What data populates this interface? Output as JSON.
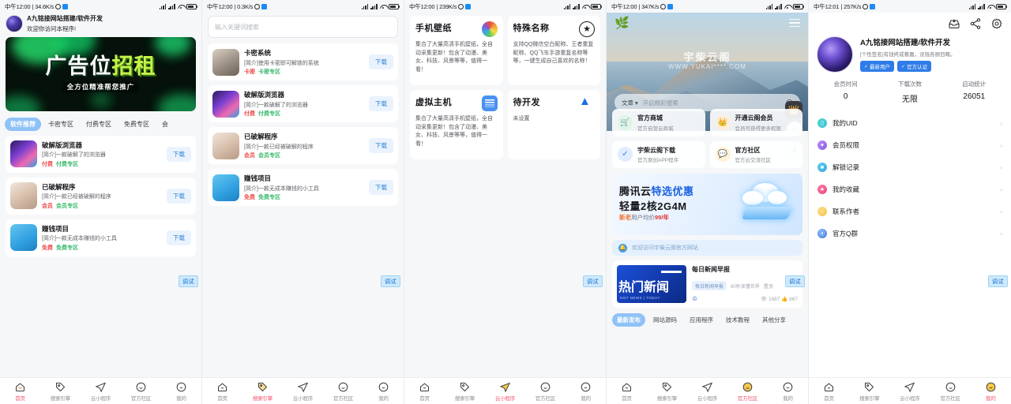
{
  "status_bar": {
    "time_1": "中午12:00",
    "net_1": "34.6K/s",
    "time_2": "中午12:00",
    "net_2": "0.3K/s",
    "time_3": "中午12:00",
    "net_3": "239K/s",
    "time_4": "中午12:00",
    "net_4": "347K/s",
    "time_5": "中午12:01",
    "net_5": "257K/s",
    "sep": "|"
  },
  "debug_label": "调试",
  "panel1": {
    "header": {
      "title": "A九铭接网站搭建/软件开发",
      "subtitle": "欢迎你访问本程序!"
    },
    "banner": {
      "main_white": "广告位",
      "main_green": "招租",
      "sub": "全方位精准帮您推广"
    },
    "tabs": [
      {
        "label": "软件推荐",
        "active": true
      },
      {
        "label": "卡密专区",
        "active": false
      },
      {
        "label": "付费专区",
        "active": false
      },
      {
        "label": "免费专区",
        "active": false
      },
      {
        "label": "会",
        "active": false
      }
    ],
    "items": [
      {
        "title": "破解版浏览器",
        "desc": "[简介]一款破解了的浏览器",
        "tag1": "付费",
        "tag2": "付费专区",
        "btn": "下载"
      },
      {
        "title": "已破解程序",
        "desc": "[简介]一款已经被破解的程序",
        "tag1": "会员",
        "tag2": "会员专区",
        "btn": "下载"
      },
      {
        "title": "赚钱项目",
        "desc": "[简介]一款无成本赚钱的小工具",
        "tag1": "免费",
        "tag2": "免费专区",
        "btn": "下载"
      }
    ]
  },
  "panel2": {
    "search_placeholder": "输入关键词搜索",
    "items": [
      {
        "title": "卡密系统",
        "desc": "[简介]使用卡密即可解锁的系统",
        "tag1": "卡密",
        "tag2": "卡密专区",
        "btn": "下载"
      },
      {
        "title": "破解版浏览器",
        "desc": "[简介]一款破解了的浏览器",
        "tag1": "付费",
        "tag2": "付费专区",
        "btn": "下载"
      },
      {
        "title": "已破解程序",
        "desc": "[简介]一款已经被破解的程序",
        "tag1": "会员",
        "tag2": "会员专区",
        "btn": "下载"
      },
      {
        "title": "赚钱项目",
        "desc": "[简介]一款无成本赚钱的小工具",
        "tag1": "免费",
        "tag2": "免费专区",
        "btn": "下载"
      }
    ]
  },
  "panel3": {
    "cards": [
      {
        "title": "手机壁纸",
        "desc": "集合了大量高清手机壁纸，全自动采集更新！包含了动漫、美女、科技、风景等等，值得一看！",
        "icon": "color-wheel-icon"
      },
      {
        "title": "特殊名称",
        "desc": "支持QQ微信空白昵称、王者重复昵称、QQ飞车手游重复名称等等，一键生成自己喜欢的名称！",
        "icon": "star-circle-icon"
      },
      {
        "title": "虚拟主机",
        "desc": "集合了大量高清手机壁纸，全自动采集更新！包含了动漫、美女、科技、风景等等，值得一看！",
        "icon": "server-list-icon"
      },
      {
        "title": "待开发",
        "desc": "未设置",
        "icon": "wings-icon"
      }
    ]
  },
  "panel4": {
    "hero": {
      "title": "宇柴云阁",
      "url": "WWW.YUKAI****.COM",
      "logo": "leaf-logo-icon",
      "menu": "hamburger-icon"
    },
    "search": {
      "scope": "文章",
      "placeholder": "开启精彩搜索"
    },
    "quick_links": [
      {
        "title": "官方商城",
        "sub": "官方自营云商城",
        "icon": "shop-icon"
      },
      {
        "title": "开通云阁会员",
        "sub": "会员可获得更多权限",
        "icon": "crown-icon"
      },
      {
        "title": "宇柴云阁下载",
        "sub": "官方原创APP程序",
        "icon": "verified-icon"
      },
      {
        "title": "官方社区",
        "sub": "官方云交流社区",
        "icon": "community-icon"
      }
    ],
    "ad": {
      "line1_a": "腾讯云",
      "line1_b": "特选优惠",
      "line2": "轻量2核2G4M",
      "line3_a": "新老",
      "line3_b": "用户均价",
      "line3_c": "99/年"
    },
    "notice": "欢迎访问宇柴云阁官方网站",
    "news": {
      "title": "每日新闻早报",
      "img_text": "热门新闻",
      "img_sub": "HOT NEWS | TODAY",
      "tag1": "每日新闻早报",
      "tag2": "60秒读懂世界",
      "tag3": "置顶",
      "views": "1687",
      "likes": "667"
    },
    "filters": [
      {
        "label": "最新发布",
        "active": true
      },
      {
        "label": "网站源码",
        "active": false
      },
      {
        "label": "应用程序",
        "active": false
      },
      {
        "label": "技术教程",
        "active": false
      },
      {
        "label": "其他分享",
        "active": false
      }
    ],
    "fabs": [
      "crown-fab-icon",
      "plus-fab-icon",
      "scroll-top-fab-icon"
    ]
  },
  "panel5": {
    "actions": [
      "inbox-icon",
      "share-icon",
      "gear-icon"
    ],
    "name": "A九铭接网站搭建/软件开发",
    "signature": "[个性签名]有钱终成眷属，没钱各顾目睹。",
    "badges": [
      {
        "label": "最新用户",
        "icon": "check-icon"
      },
      {
        "label": "官方认证",
        "icon": "check-icon"
      }
    ],
    "stats": [
      {
        "label": "会员时间",
        "value": "0"
      },
      {
        "label": "下载次数",
        "value": "无限"
      },
      {
        "label": "启动统计",
        "value": "26051"
      }
    ],
    "rows": [
      {
        "label": "我的UID",
        "icon": "card-icon"
      },
      {
        "label": "会员权限",
        "icon": "vip-icon"
      },
      {
        "label": "解锁记录",
        "icon": "unlock-icon"
      },
      {
        "label": "我的收藏",
        "icon": "star-icon"
      },
      {
        "label": "联系作者",
        "icon": "contact-icon"
      },
      {
        "label": "官方Q群",
        "icon": "qq-icon"
      }
    ],
    "chevron": "›"
  },
  "tabbar": [
    {
      "label": "首页",
      "icon": "home-icon"
    },
    {
      "label": "搜索引擎",
      "icon": "tag-icon"
    },
    {
      "label": "云小程序",
      "icon": "paperplane-icon"
    },
    {
      "label": "官方社区",
      "icon": "smiley-icon"
    },
    {
      "label": "我的",
      "icon": "profile-icon"
    }
  ],
  "tabbar_active": [
    0,
    1,
    2,
    3,
    4
  ],
  "colors": {
    "accent_pink": "#f5556d",
    "accent_blue": "#8fc2f6",
    "link_blue": "#2f83d8"
  }
}
